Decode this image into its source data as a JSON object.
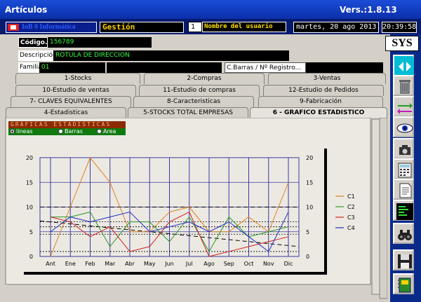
{
  "window": {
    "title": "Artículos",
    "version": "Vers.:1.8.13"
  },
  "header": {
    "company": "IoB 0 Informática",
    "module": "Gestión",
    "user_number": "1",
    "user_name": "Nombre del usuario",
    "date": "martes, 20 ago 2013",
    "time": "20:39:58"
  },
  "fields": {
    "codigo_label": "Código..",
    "codigo_value": "156789",
    "descripcion_label": "Descripción..",
    "descripcion_value": "ROTULA DE DIRECCION",
    "familia_label": "Familia..",
    "familia_value": "01",
    "cbarras_label": "C.Barras / Nº Registro..."
  },
  "sidebar": {
    "sys_label": "SYS",
    "buttons": [
      "nav-arrows-icon",
      "trash-icon",
      "swap-arrows-icon",
      "eye-icon",
      "camera-icon",
      "calculator-icon",
      "document-icon",
      "terminal-icon",
      "binoculars-icon",
      "save-icon",
      "notebook-icon"
    ]
  },
  "tabs": [
    [
      "1-Stocks",
      "2-Compras",
      "3-Ventas"
    ],
    [
      "10-Estudio de ventas",
      "11-Estudio de compras",
      "12-Estudio de Pedidos"
    ],
    [
      "7- CLAVES EQUIVALENTES",
      "8-Caracteristicas",
      "9-Fabricación"
    ],
    [
      "4-Estadisticas",
      "5-STOCKS TOTAL EMPRESAS",
      "6 - GRAFICO ESTADISTICO"
    ]
  ],
  "graph_panel": {
    "title": "GRAFICAS ESTADISTICAS",
    "options": [
      "lineas",
      "Barras",
      "Area"
    ],
    "selected": "lineas"
  },
  "colors": {
    "c1": "#e08020",
    "c2": "#2a9a2a",
    "c3": "#d02020",
    "c4": "#2030c0"
  },
  "chart_data": {
    "type": "line",
    "categories": [
      "Ant",
      "Ene",
      "Feb",
      "Mar",
      "Abr",
      "May",
      "Jun",
      "Jul",
      "Ago",
      "Sep",
      "Oct",
      "Nov",
      "Dic"
    ],
    "ylim": [
      0,
      20
    ],
    "yticks": [
      0,
      5,
      10,
      15,
      20
    ],
    "legend_position": "right",
    "series": [
      {
        "name": "C1",
        "values": [
          0,
          10,
          20,
          15,
          5,
          5,
          9,
          10,
          5,
          5,
          8,
          5,
          15
        ]
      },
      {
        "name": "C2",
        "values": [
          8,
          8,
          9,
          2,
          7,
          7,
          3,
          8,
          1,
          8,
          4,
          5,
          6
        ]
      },
      {
        "name": "C3",
        "values": [
          8,
          7,
          4,
          6,
          1,
          2,
          7,
          9,
          0,
          1,
          2,
          3,
          4
        ]
      },
      {
        "name": "C4",
        "values": [
          5,
          8,
          7,
          8,
          9,
          5,
          6,
          7,
          5,
          7,
          4,
          1,
          9
        ]
      }
    ]
  }
}
